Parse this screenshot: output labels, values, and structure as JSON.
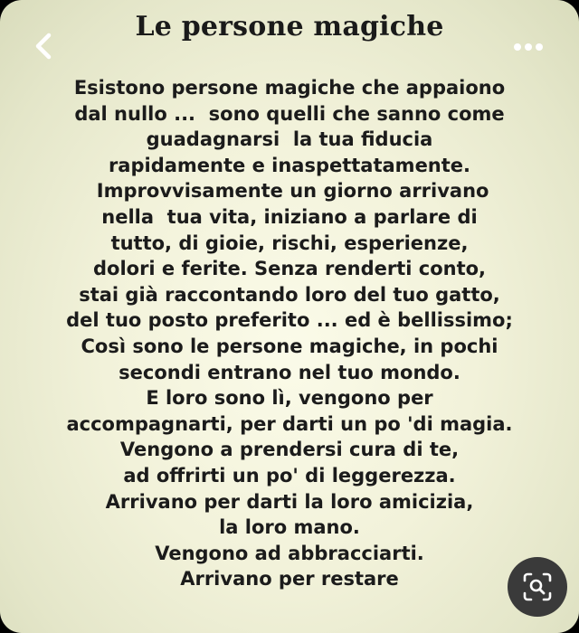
{
  "header": {
    "back_icon": "chevron-left-icon",
    "more_icon": "more-horizontal-icon"
  },
  "image": {
    "title": "Le persone magiche",
    "lines": [
      "Esistono persone magiche che appaiono",
      "dal nullo ...  sono quelli che sanno come",
      "guadagnarsi  la tua fiducia",
      "rapidamente e inaspettatamente.",
      " Improvvisamente un giorno arrivano",
      "nella  tua vita, iniziano a parlare di",
      "tutto, di gioie, rischi, esperienze,",
      "dolori e ferite. Senza renderti conto,",
      "stai già raccontando loro del tuo gatto,",
      "del tuo posto preferito ... ed è bellissimo;",
      "Così sono le persone magiche, in pochi",
      "secondi entrano nel tuo mondo.",
      "E loro sono lì, vengono per",
      "accompagnarti, per darti un po 'di magia.",
      "Vengono a prendersi cura di te,",
      "ad offrirti un po' di leggerezza.",
      "Arrivano per darti la loro amicizia,",
      "la loro mano.",
      "Vengono ad abbracciarti.",
      "Arrivano per restare"
    ]
  },
  "actions": {
    "visual_search_icon": "lens-search-icon"
  },
  "colors": {
    "card_background": "#f2f2da",
    "text": "#1b1b1b",
    "lens_button": "#3a3a3a"
  }
}
